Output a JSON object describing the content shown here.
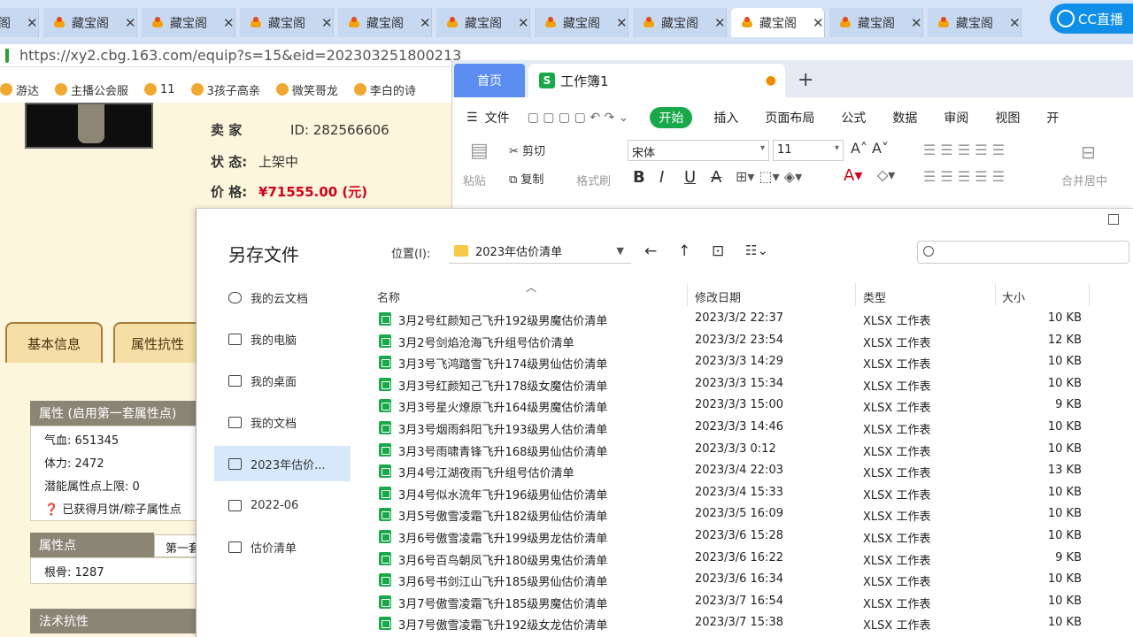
{
  "browser": {
    "tabs": [
      {
        "title": "藏宝阁",
        "active": false
      },
      {
        "title": "藏宝阁",
        "active": false
      },
      {
        "title": "藏宝阁",
        "active": false
      },
      {
        "title": "藏宝阁",
        "active": false
      },
      {
        "title": "藏宝阁",
        "active": false
      },
      {
        "title": "藏宝阁",
        "active": false
      },
      {
        "title": "藏宝阁",
        "active": false
      },
      {
        "title": "藏宝阁",
        "active": false
      },
      {
        "title": "藏宝阁",
        "active": true
      },
      {
        "title": "藏宝阁",
        "active": false
      },
      {
        "title": "藏宝阁",
        "active": false
      }
    ],
    "cc_label": "CC直播",
    "url": "https://xy2.cbg.163.com/equip?s=15&eid=202303251800213",
    "bookmarks": [
      "游达",
      "主播公会服",
      "11",
      "3孩子高亲",
      "微笑哥龙",
      "李白的诗"
    ]
  },
  "listing": {
    "seller_label": "卖  家",
    "seller_id": "ID: 282566606",
    "status_label": "状        态:",
    "status_value": "上架中",
    "price_label": "价        格:",
    "price_value": "¥71555.00 (元)",
    "tabs": [
      "基本信息",
      "属性抗性"
    ],
    "attr_header": "属性 (启用第一套属性点)",
    "hp": "气血: 651345",
    "stamina": "体力: 2472",
    "potential": "潜能属性点上限: 0",
    "cake_note": "已获得月饼/粽子属性点",
    "points_header": "属性点",
    "points_tab": "第一套",
    "root_bone": "根骨: 1287",
    "resist_header": "法术抗性"
  },
  "wps": {
    "home_tab": "首页",
    "book_tab": "工作簿1",
    "menu": [
      "文件",
      "开始",
      "插入",
      "页面布局",
      "公式",
      "数据",
      "审阅",
      "视图",
      "开"
    ],
    "cut": "剪切",
    "copy": "复制",
    "paste": "粘贴",
    "format_painter": "格式刷",
    "font": "宋体",
    "font_size": "11",
    "merge": "合并居中"
  },
  "dialog": {
    "title": "另存文件",
    "location_label": "位置(I):",
    "location_value": "2023年估价清单",
    "sidebar": [
      {
        "label": "我的云文档",
        "icon": "cloud-icon",
        "active": false
      },
      {
        "label": "我的电脑",
        "icon": "computer-icon",
        "active": false
      },
      {
        "label": "我的桌面",
        "icon": "desktop-icon",
        "active": false
      },
      {
        "label": "我的文档",
        "icon": "folder-icon",
        "active": false
      },
      {
        "label": "2023年估价...",
        "icon": "folder-icon",
        "active": true
      },
      {
        "label": "2022-06",
        "icon": "folder-icon",
        "active": false
      },
      {
        "label": "估价清单",
        "icon": "folder-icon",
        "active": false
      }
    ],
    "columns": {
      "name": "名称",
      "date": "修改日期",
      "type": "类型",
      "size": "大小"
    },
    "files": [
      {
        "name": "3月2号红颜知己飞升192级男魔估价清单",
        "date": "2023/3/2 22:37",
        "type": "XLSX 工作表",
        "size": "10 KB"
      },
      {
        "name": "3月2号剑焰沧海飞升组号估价清单",
        "date": "2023/3/2 23:54",
        "type": "XLSX 工作表",
        "size": "12 KB"
      },
      {
        "name": "3月3号飞鸿踏雪飞升174级男仙估价清单",
        "date": "2023/3/3 14:29",
        "type": "XLSX 工作表",
        "size": "10 KB"
      },
      {
        "name": "3月3号红颜知己飞升178级女魔估价清单",
        "date": "2023/3/3 15:34",
        "type": "XLSX 工作表",
        "size": "10 KB"
      },
      {
        "name": "3月3号星火燎原飞升164级男魔估价清单",
        "date": "2023/3/3 15:00",
        "type": "XLSX 工作表",
        "size": "9 KB"
      },
      {
        "name": "3月3号烟雨斜阳飞升193级男人估价清单",
        "date": "2023/3/3 14:46",
        "type": "XLSX 工作表",
        "size": "10 KB"
      },
      {
        "name": "3月3号雨啸青锋飞升168级男仙估价清单",
        "date": "2023/3/3 0:12",
        "type": "XLSX 工作表",
        "size": "10 KB"
      },
      {
        "name": "3月4号江湖夜雨飞升组号估价清单",
        "date": "2023/3/4 22:03",
        "type": "XLSX 工作表",
        "size": "13 KB"
      },
      {
        "name": "3月4号似水流年飞升196级男仙估价清单",
        "date": "2023/3/4 15:33",
        "type": "XLSX 工作表",
        "size": "10 KB"
      },
      {
        "name": "3月5号傲雪凌霜飞升182级男仙估价清单",
        "date": "2023/3/5 16:09",
        "type": "XLSX 工作表",
        "size": "10 KB"
      },
      {
        "name": "3月6号傲雪凌霜飞升199级男龙估价清单",
        "date": "2023/3/6 15:28",
        "type": "XLSX 工作表",
        "size": "10 KB"
      },
      {
        "name": "3月6号百鸟朝凤飞升180级男鬼估价清单",
        "date": "2023/3/6 16:22",
        "type": "XLSX 工作表",
        "size": "9 KB"
      },
      {
        "name": "3月6号书剑江山飞升185级男仙估价清单",
        "date": "2023/3/6 16:34",
        "type": "XLSX 工作表",
        "size": "10 KB"
      },
      {
        "name": "3月7号傲雪凌霜飞升185级男魔估价清单",
        "date": "2023/3/7 16:54",
        "type": "XLSX 工作表",
        "size": "10 KB"
      },
      {
        "name": "3月7号傲雪凌霜飞升192级女龙估价清单",
        "date": "2023/3/7 15:38",
        "type": "XLSX 工作表",
        "size": "10 KB"
      }
    ]
  }
}
